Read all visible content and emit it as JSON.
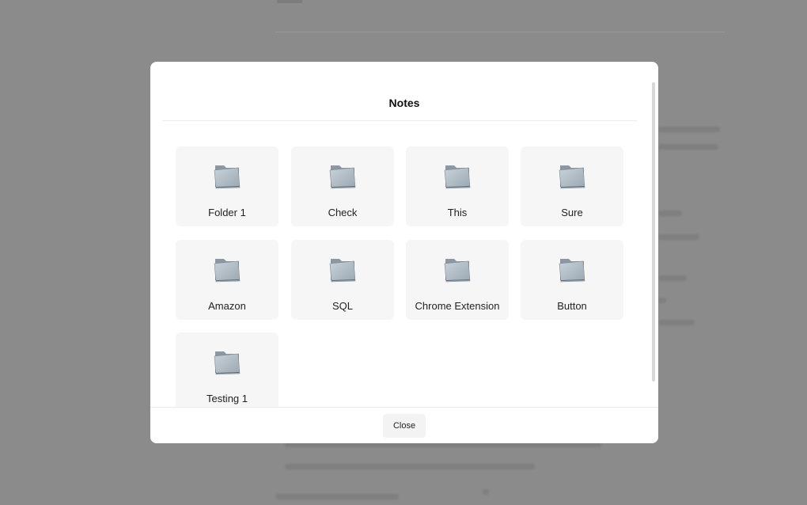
{
  "modal": {
    "title": "Notes",
    "close_label": "Close"
  },
  "folders": [
    {
      "label": "Folder 1",
      "icon": "folder-icon"
    },
    {
      "label": "Check",
      "icon": "folder-icon"
    },
    {
      "label": "This",
      "icon": "folder-icon"
    },
    {
      "label": "Sure",
      "icon": "folder-icon"
    },
    {
      "label": "Amazon",
      "icon": "folder-icon"
    },
    {
      "label": "SQL",
      "icon": "folder-icon"
    },
    {
      "label": "Chrome Extension",
      "icon": "folder-icon"
    },
    {
      "label": "Button",
      "icon": "folder-icon"
    },
    {
      "label": "Testing 1",
      "icon": "folder-icon"
    }
  ],
  "colors": {
    "overlay": "#8c8c8c",
    "modal_background": "#ffffff",
    "tile_background": "#f6f6f6",
    "folder_light": "#b8c3cc",
    "folder_dark": "#7d8a95"
  }
}
